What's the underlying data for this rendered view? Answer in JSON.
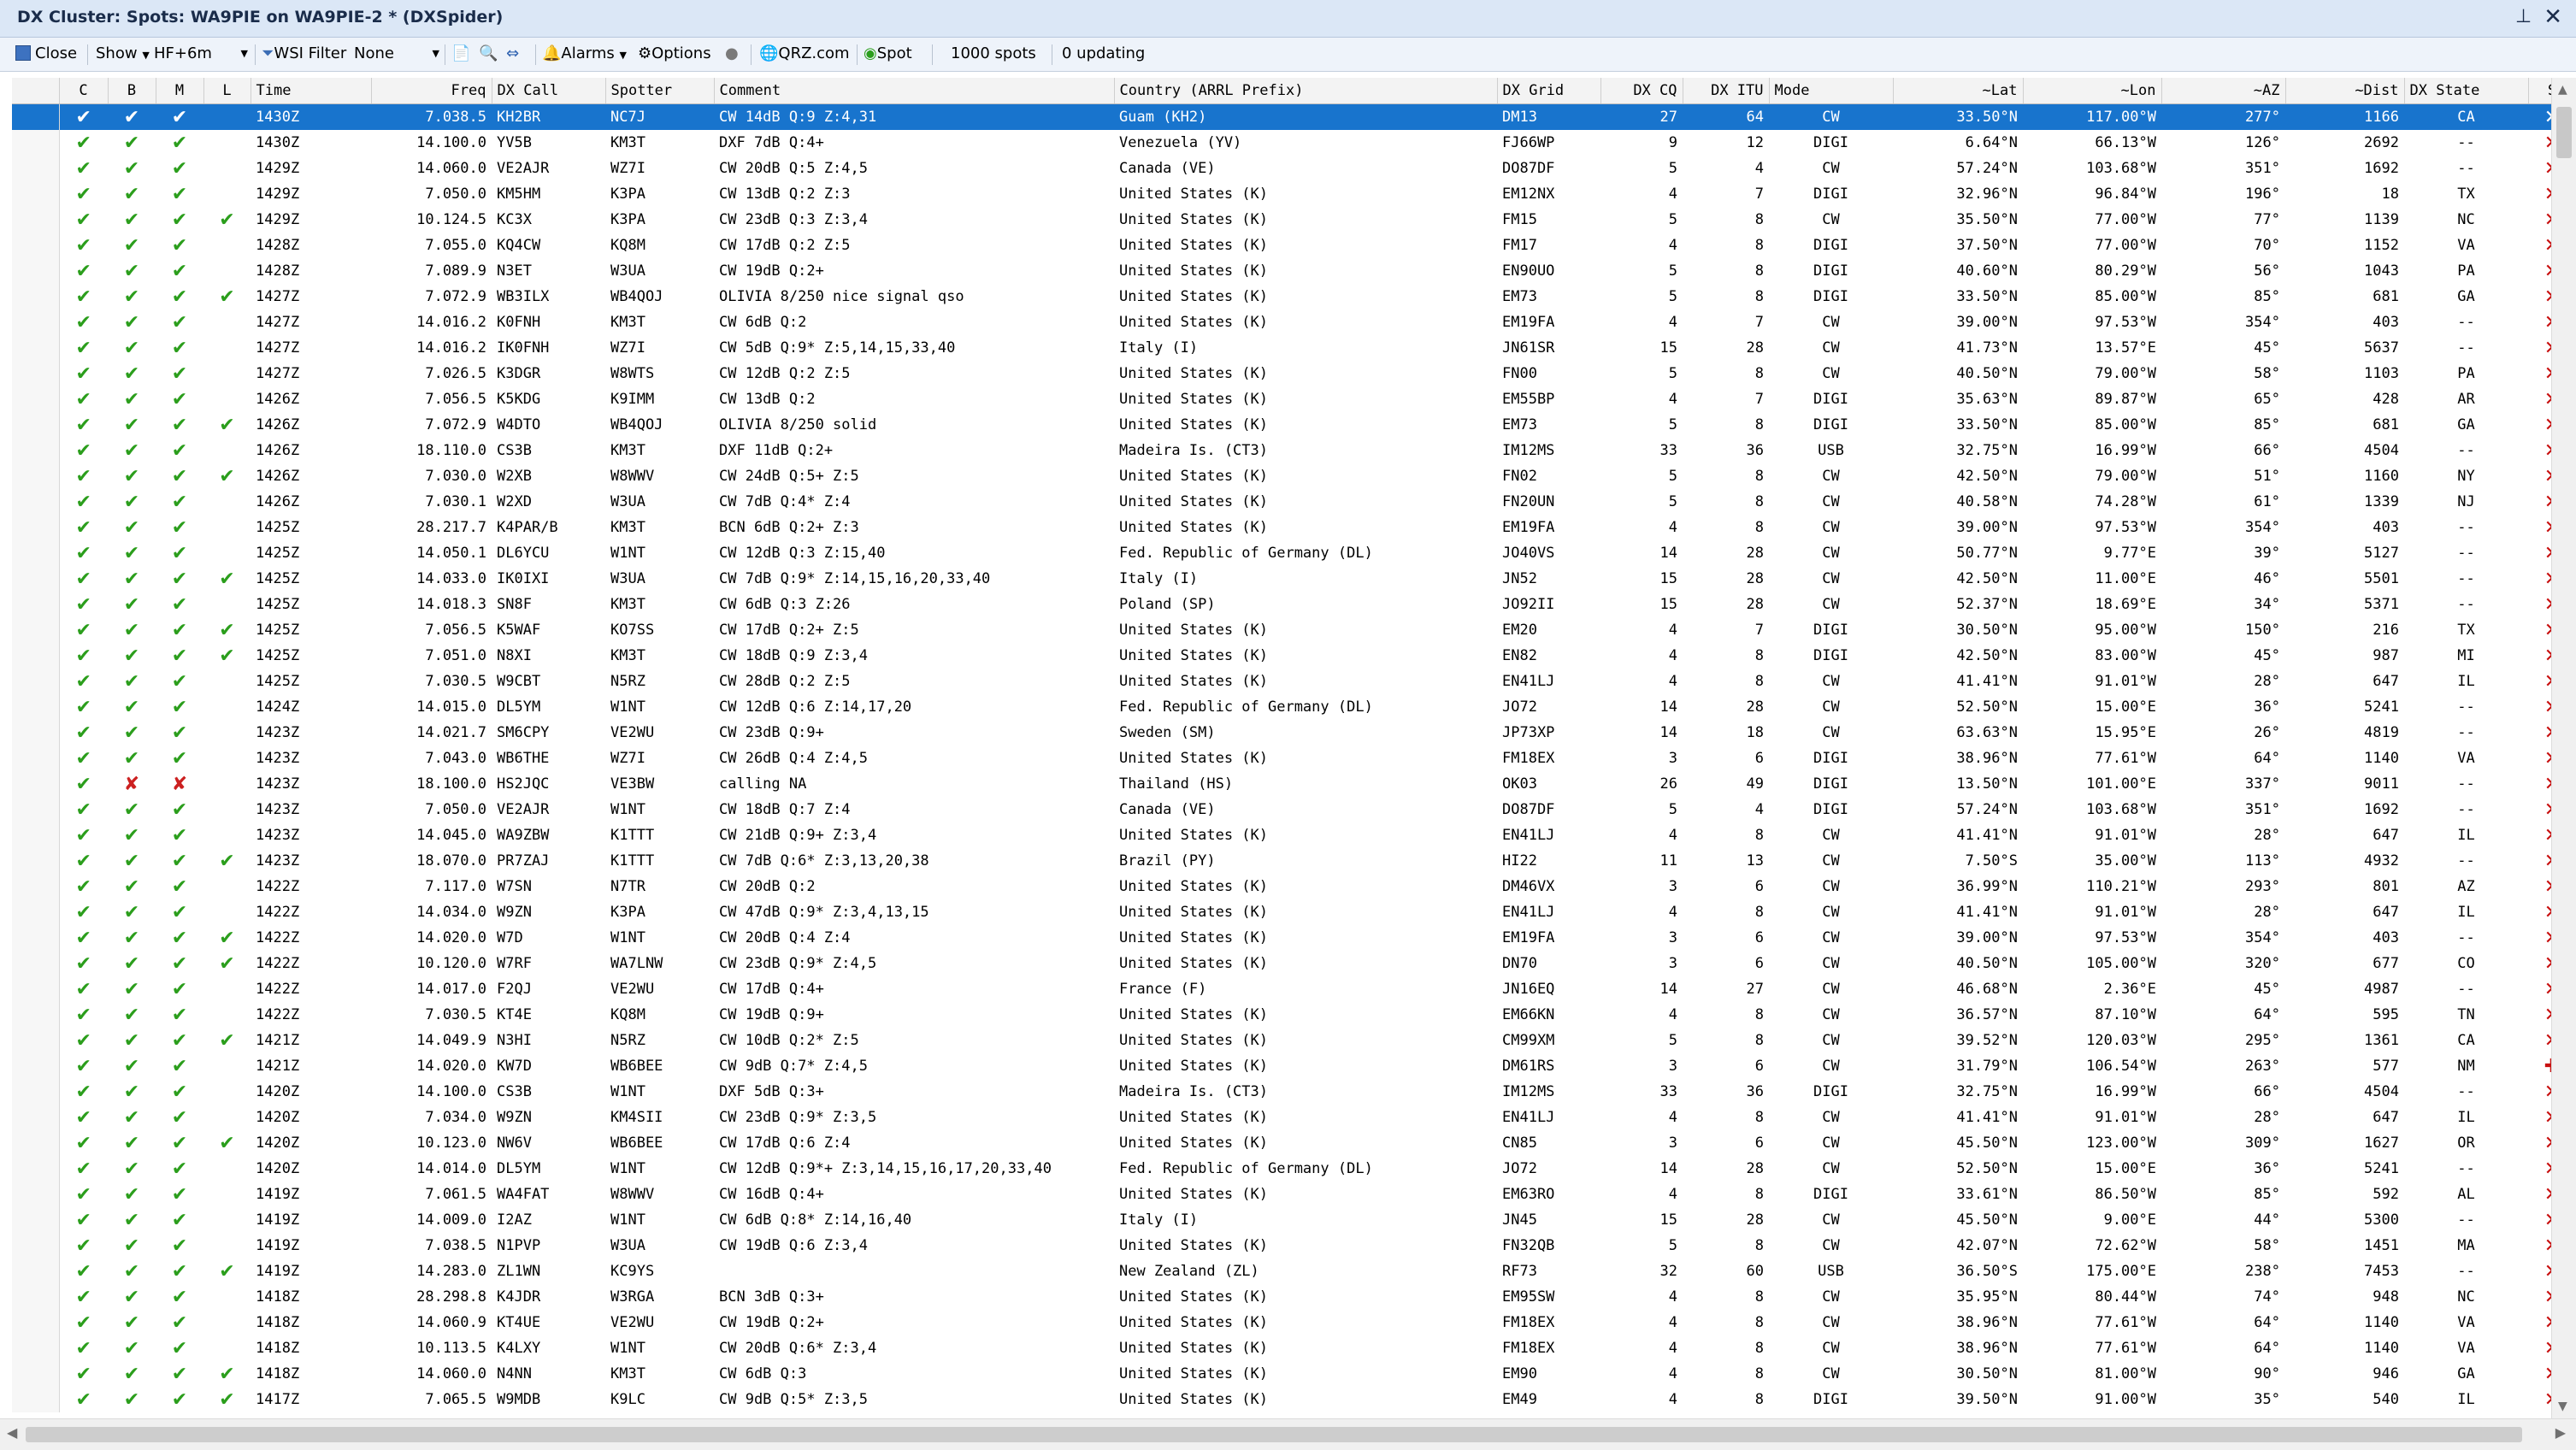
{
  "window": {
    "title": "DX Cluster: Spots: WA9PIE on WA9PIE-2 * (DXSpider)"
  },
  "toolbar": {
    "close_label": "Close",
    "show_label": "Show",
    "band_value": "HF+6m",
    "wsi_filter_label": "WSI Filter",
    "filter_value": "None",
    "alarms_label": "Alarms",
    "options_label": "Options",
    "qrz_label": "QRZ.com",
    "spot_label": "Spot",
    "spots_count": "1000 spots",
    "updating": "0 updating"
  },
  "columns": [
    "C",
    "B",
    "M",
    "L",
    "Time",
    "Freq",
    "DX Call",
    "Spotter",
    "Comment",
    "Country (ARRL Prefix)",
    "DX Grid",
    "DX CQ",
    "DX ITU",
    "Mode",
    "~Lat",
    "~Lon",
    "~AZ",
    "~Dist",
    "DX State",
    "S"
  ],
  "rows": [
    [
      "y",
      "y",
      "y",
      "",
      "1430Z",
      "7.038.5",
      "KH2BR",
      "NC7J",
      "CW  14dB Q:9 Z:4,31",
      "Guam (KH2)",
      "DM13",
      "27",
      "64",
      "CW",
      "33.50°N",
      "117.00°W",
      "277°",
      "1166",
      "CA",
      "x"
    ],
    [
      "y",
      "y",
      "y",
      "",
      "1430Z",
      "14.100.0",
      "YV5B",
      "KM3T",
      "DXF  7dB Q:4+",
      "Venezuela (YV)",
      "FJ66WP",
      "9",
      "12",
      "DIGI",
      "6.64°N",
      "66.13°W",
      "126°",
      "2692",
      "--",
      "x"
    ],
    [
      "y",
      "y",
      "y",
      "",
      "1429Z",
      "14.060.0",
      "VE2AJR",
      "WZ7I",
      "CW  20dB Q:5 Z:4,5",
      "Canada (VE)",
      "DO87DF",
      "5",
      "4",
      "CW",
      "57.24°N",
      "103.68°W",
      "351°",
      "1692",
      "--",
      "x"
    ],
    [
      "y",
      "y",
      "y",
      "",
      "1429Z",
      "7.050.0",
      "KM5HM",
      "K3PA",
      "CW  13dB Q:2 Z:3",
      "United States (K)",
      "EM12NX",
      "4",
      "7",
      "DIGI",
      "32.96°N",
      "96.84°W",
      "196°",
      "18",
      "TX",
      "x"
    ],
    [
      "y",
      "y",
      "y",
      "y",
      "1429Z",
      "10.124.5",
      "KC3X",
      "K3PA",
      "CW  23dB Q:3 Z:3,4",
      "United States (K)",
      "FM15",
      "5",
      "8",
      "CW",
      "35.50°N",
      "77.00°W",
      "77°",
      "1139",
      "NC",
      "x"
    ],
    [
      "y",
      "y",
      "y",
      "",
      "1428Z",
      "7.055.0",
      "KQ4CW",
      "KQ8M",
      "CW  17dB Q:2 Z:5",
      "United States (K)",
      "FM17",
      "4",
      "8",
      "DIGI",
      "37.50°N",
      "77.00°W",
      "70°",
      "1152",
      "VA",
      "x"
    ],
    [
      "y",
      "y",
      "y",
      "",
      "1428Z",
      "7.089.9",
      "N3ET",
      "W3UA",
      "CW  19dB Q:2+",
      "United States (K)",
      "EN90UO",
      "5",
      "8",
      "DIGI",
      "40.60°N",
      "80.29°W",
      "56°",
      "1043",
      "PA",
      "x"
    ],
    [
      "y",
      "y",
      "y",
      "y",
      "1427Z",
      "7.072.9",
      "WB3ILX",
      "WB4QOJ",
      "OLIVIA 8/250 nice signal qso",
      "United States (K)",
      "EM73",
      "5",
      "8",
      "DIGI",
      "33.50°N",
      "85.00°W",
      "85°",
      "681",
      "GA",
      "x"
    ],
    [
      "y",
      "y",
      "y",
      "",
      "1427Z",
      "14.016.2",
      "K0FNH",
      "KM3T",
      "CW   6dB Q:2",
      "United States (K)",
      "EM19FA",
      "4",
      "7",
      "CW",
      "39.00°N",
      "97.53°W",
      "354°",
      "403",
      "--",
      "x"
    ],
    [
      "y",
      "y",
      "y",
      "",
      "1427Z",
      "14.016.2",
      "IK0FNH",
      "WZ7I",
      "CW   5dB Q:9* Z:5,14,15,33,40",
      "Italy (I)",
      "JN61SR",
      "15",
      "28",
      "CW",
      "41.73°N",
      "13.57°E",
      "45°",
      "5637",
      "--",
      "x"
    ],
    [
      "y",
      "y",
      "y",
      "",
      "1427Z",
      "7.026.5",
      "K3DGR",
      "W8WTS",
      "CW  12dB Q:2 Z:5",
      "United States (K)",
      "FN00",
      "5",
      "8",
      "CW",
      "40.50°N",
      "79.00°W",
      "58°",
      "1103",
      "PA",
      "x"
    ],
    [
      "y",
      "y",
      "y",
      "",
      "1426Z",
      "7.056.5",
      "K5KDG",
      "K9IMM",
      "CW  13dB Q:2",
      "United States (K)",
      "EM55BP",
      "4",
      "7",
      "DIGI",
      "35.63°N",
      "89.87°W",
      "65°",
      "428",
      "AR",
      "x"
    ],
    [
      "y",
      "y",
      "y",
      "y",
      "1426Z",
      "7.072.9",
      "W4DTO",
      "WB4QOJ",
      "OLIVIA 8/250 solid",
      "United States (K)",
      "EM73",
      "5",
      "8",
      "DIGI",
      "33.50°N",
      "85.00°W",
      "85°",
      "681",
      "GA",
      "x"
    ],
    [
      "y",
      "y",
      "y",
      "",
      "1426Z",
      "18.110.0",
      "CS3B",
      "KM3T",
      "DXF 11dB Q:2+",
      "Madeira Is. (CT3)",
      "IM12MS",
      "33",
      "36",
      "USB",
      "32.75°N",
      "16.99°W",
      "66°",
      "4504",
      "--",
      "x"
    ],
    [
      "y",
      "y",
      "y",
      "y",
      "1426Z",
      "7.030.0",
      "W2XB",
      "W8WWV",
      "CW  24dB Q:5+ Z:5",
      "United States (K)",
      "FN02",
      "5",
      "8",
      "CW",
      "42.50°N",
      "79.00°W",
      "51°",
      "1160",
      "NY",
      "x"
    ],
    [
      "y",
      "y",
      "y",
      "",
      "1426Z",
      "7.030.1",
      "W2XD",
      "W3UA",
      "CW   7dB Q:4* Z:4",
      "United States (K)",
      "FN20UN",
      "5",
      "8",
      "CW",
      "40.58°N",
      "74.28°W",
      "61°",
      "1339",
      "NJ",
      "x"
    ],
    [
      "y",
      "y",
      "y",
      "",
      "1425Z",
      "28.217.7",
      "K4PAR/B",
      "KM3T",
      "BCN  6dB Q:2+ Z:3",
      "United States (K)",
      "EM19FA",
      "4",
      "8",
      "CW",
      "39.00°N",
      "97.53°W",
      "354°",
      "403",
      "--",
      "x"
    ],
    [
      "y",
      "y",
      "y",
      "",
      "1425Z",
      "14.050.1",
      "DL6YCU",
      "W1NT",
      "CW  12dB Q:3 Z:15,40",
      "Fed. Republic of Germany (DL)",
      "JO40VS",
      "14",
      "28",
      "CW",
      "50.77°N",
      "9.77°E",
      "39°",
      "5127",
      "--",
      "x"
    ],
    [
      "y",
      "y",
      "y",
      "y",
      "1425Z",
      "14.033.0",
      "IK0IXI",
      "W3UA",
      "CW   7dB Q:9* Z:14,15,16,20,33,40",
      "Italy (I)",
      "JN52",
      "15",
      "28",
      "CW",
      "42.50°N",
      "11.00°E",
      "46°",
      "5501",
      "--",
      "x"
    ],
    [
      "y",
      "y",
      "y",
      "",
      "1425Z",
      "14.018.3",
      "SN8F",
      "KM3T",
      "CW   6dB Q:3 Z:26",
      "Poland (SP)",
      "JO92II",
      "15",
      "28",
      "CW",
      "52.37°N",
      "18.69°E",
      "34°",
      "5371",
      "--",
      "x"
    ],
    [
      "y",
      "y",
      "y",
      "y",
      "1425Z",
      "7.056.5",
      "K5WAF",
      "KO7SS",
      "CW  17dB Q:2+ Z:5",
      "United States (K)",
      "EM20",
      "4",
      "7",
      "DIGI",
      "30.50°N",
      "95.00°W",
      "150°",
      "216",
      "TX",
      "x"
    ],
    [
      "y",
      "y",
      "y",
      "y",
      "1425Z",
      "7.051.0",
      "N8XI",
      "KM3T",
      "CW  18dB Q:9 Z:3,4",
      "United States (K)",
      "EN82",
      "4",
      "8",
      "DIGI",
      "42.50°N",
      "83.00°W",
      "45°",
      "987",
      "MI",
      "x"
    ],
    [
      "y",
      "y",
      "y",
      "",
      "1425Z",
      "7.030.5",
      "W9CBT",
      "N5RZ",
      "CW  28dB Q:2 Z:5",
      "United States (K)",
      "EN41LJ",
      "4",
      "8",
      "CW",
      "41.41°N",
      "91.01°W",
      "28°",
      "647",
      "IL",
      "x"
    ],
    [
      "y",
      "y",
      "y",
      "",
      "1424Z",
      "14.015.0",
      "DL5YM",
      "W1NT",
      "CW  12dB Q:6 Z:14,17,20",
      "Fed. Republic of Germany (DL)",
      "JO72",
      "14",
      "28",
      "CW",
      "52.50°N",
      "15.00°E",
      "36°",
      "5241",
      "--",
      "x"
    ],
    [
      "y",
      "y",
      "y",
      "",
      "1423Z",
      "14.021.7",
      "SM6CPY",
      "VE2WU",
      "CW  23dB Q:9+",
      "Sweden (SM)",
      "JP73XP",
      "14",
      "18",
      "CW",
      "63.63°N",
      "15.95°E",
      "26°",
      "4819",
      "--",
      "x"
    ],
    [
      "y",
      "y",
      "y",
      "",
      "1423Z",
      "7.043.0",
      "WB6THE",
      "WZ7I",
      "CW  26dB Q:4 Z:4,5",
      "United States (K)",
      "FM18EX",
      "3",
      "6",
      "DIGI",
      "38.96°N",
      "77.61°W",
      "64°",
      "1140",
      "VA",
      "x"
    ],
    [
      "y",
      "n",
      "n",
      "",
      "1423Z",
      "18.100.0",
      "HS2JQC",
      "VE3BW",
      "calling NA",
      "Thailand (HS)",
      "OK03",
      "26",
      "49",
      "DIGI",
      "13.50°N",
      "101.00°E",
      "337°",
      "9011",
      "--",
      "x"
    ],
    [
      "y",
      "y",
      "y",
      "",
      "1423Z",
      "7.050.0",
      "VE2AJR",
      "W1NT",
      "CW  18dB Q:7 Z:4",
      "Canada (VE)",
      "DO87DF",
      "5",
      "4",
      "DIGI",
      "57.24°N",
      "103.68°W",
      "351°",
      "1692",
      "--",
      "x"
    ],
    [
      "y",
      "y",
      "y",
      "",
      "1423Z",
      "14.045.0",
      "WA9ZBW",
      "K1TTT",
      "CW  21dB Q:9+ Z:3,4",
      "United States (K)",
      "EN41LJ",
      "4",
      "8",
      "CW",
      "41.41°N",
      "91.01°W",
      "28°",
      "647",
      "IL",
      "x"
    ],
    [
      "y",
      "y",
      "y",
      "y",
      "1423Z",
      "18.070.0",
      "PR7ZAJ",
      "K1TTT",
      "CW   7dB Q:6* Z:3,13,20,38",
      "Brazil (PY)",
      "HI22",
      "11",
      "13",
      "CW",
      "7.50°S",
      "35.00°W",
      "113°",
      "4932",
      "--",
      "x"
    ],
    [
      "y",
      "y",
      "y",
      "",
      "1422Z",
      "7.117.0",
      "W7SN",
      "N7TR",
      "CW  20dB Q:2",
      "United States (K)",
      "DM46VX",
      "3",
      "6",
      "CW",
      "36.99°N",
      "110.21°W",
      "293°",
      "801",
      "AZ",
      "x"
    ],
    [
      "y",
      "y",
      "y",
      "",
      "1422Z",
      "14.034.0",
      "W9ZN",
      "K3PA",
      "CW  47dB Q:9* Z:3,4,13,15",
      "United States (K)",
      "EN41LJ",
      "4",
      "8",
      "CW",
      "41.41°N",
      "91.01°W",
      "28°",
      "647",
      "IL",
      "x"
    ],
    [
      "y",
      "y",
      "y",
      "y",
      "1422Z",
      "14.020.0",
      "W7D",
      "W1NT",
      "CW  20dB Q:4 Z:4",
      "United States (K)",
      "EM19FA",
      "3",
      "6",
      "CW",
      "39.00°N",
      "97.53°W",
      "354°",
      "403",
      "--",
      "x"
    ],
    [
      "y",
      "y",
      "y",
      "y",
      "1422Z",
      "10.120.0",
      "W7RF",
      "WA7LNW",
      "CW  23dB Q:9* Z:4,5",
      "United States (K)",
      "DN70",
      "3",
      "6",
      "CW",
      "40.50°N",
      "105.00°W",
      "320°",
      "677",
      "CO",
      "x"
    ],
    [
      "y",
      "y",
      "y",
      "",
      "1422Z",
      "14.017.0",
      "F2QJ",
      "VE2WU",
      "CW  17dB Q:4+",
      "France (F)",
      "JN16EQ",
      "14",
      "27",
      "CW",
      "46.68°N",
      "2.36°E",
      "45°",
      "4987",
      "--",
      "x"
    ],
    [
      "y",
      "y",
      "y",
      "",
      "1422Z",
      "7.030.5",
      "KT4E",
      "KQ8M",
      "CW  19dB Q:9+",
      "United States (K)",
      "EM66KN",
      "4",
      "8",
      "CW",
      "36.57°N",
      "87.10°W",
      "64°",
      "595",
      "TN",
      "x"
    ],
    [
      "y",
      "y",
      "y",
      "y",
      "1421Z",
      "14.049.9",
      "N3HI",
      "N5RZ",
      "CW  10dB Q:2* Z:5",
      "United States (K)",
      "CM99XM",
      "5",
      "8",
      "CW",
      "39.52°N",
      "120.03°W",
      "295°",
      "1361",
      "CA",
      "x"
    ],
    [
      "y",
      "y",
      "y",
      "",
      "1421Z",
      "14.020.0",
      "KW7D",
      "WB6BEE",
      "CW   9dB Q:7* Z:4,5",
      "United States (K)",
      "DM61RS",
      "3",
      "6",
      "CW",
      "31.79°N",
      "106.54°W",
      "263°",
      "577",
      "NM",
      "+"
    ],
    [
      "y",
      "y",
      "y",
      "",
      "1420Z",
      "14.100.0",
      "CS3B",
      "W1NT",
      "DXF  5dB Q:3+",
      "Madeira Is. (CT3)",
      "IM12MS",
      "33",
      "36",
      "DIGI",
      "32.75°N",
      "16.99°W",
      "66°",
      "4504",
      "--",
      "x"
    ],
    [
      "y",
      "y",
      "y",
      "",
      "1420Z",
      "7.034.0",
      "W9ZN",
      "KM4SII",
      "CW  23dB Q:9* Z:3,5",
      "United States (K)",
      "EN41LJ",
      "4",
      "8",
      "CW",
      "41.41°N",
      "91.01°W",
      "28°",
      "647",
      "IL",
      "x"
    ],
    [
      "y",
      "y",
      "y",
      "y",
      "1420Z",
      "10.123.0",
      "NW6V",
      "WB6BEE",
      "CW  17dB Q:6 Z:4",
      "United States (K)",
      "CN85",
      "3",
      "6",
      "CW",
      "45.50°N",
      "123.00°W",
      "309°",
      "1627",
      "OR",
      "x"
    ],
    [
      "y",
      "y",
      "y",
      "",
      "1420Z",
      "14.014.0",
      "DL5YM",
      "W1NT",
      "CW  12dB Q:9*+ Z:3,14,15,16,17,20,33,40",
      "Fed. Republic of Germany (DL)",
      "JO72",
      "14",
      "28",
      "CW",
      "52.50°N",
      "15.00°E",
      "36°",
      "5241",
      "--",
      "x"
    ],
    [
      "y",
      "y",
      "y",
      "",
      "1419Z",
      "7.061.5",
      "WA4FAT",
      "W8WWV",
      "CW  16dB Q:4+",
      "United States (K)",
      "EM63RO",
      "4",
      "8",
      "DIGI",
      "33.61°N",
      "86.50°W",
      "85°",
      "592",
      "AL",
      "x"
    ],
    [
      "y",
      "y",
      "y",
      "",
      "1419Z",
      "14.009.0",
      "I2AZ",
      "W1NT",
      "CW   6dB Q:8* Z:14,16,40",
      "Italy (I)",
      "JN45",
      "15",
      "28",
      "CW",
      "45.50°N",
      "9.00°E",
      "44°",
      "5300",
      "--",
      "x"
    ],
    [
      "y",
      "y",
      "y",
      "",
      "1419Z",
      "7.038.5",
      "N1PVP",
      "W3UA",
      "CW  19dB Q:6 Z:3,4",
      "United States (K)",
      "FN32QB",
      "5",
      "8",
      "CW",
      "42.07°N",
      "72.62°W",
      "58°",
      "1451",
      "MA",
      "x"
    ],
    [
      "y",
      "y",
      "y",
      "y",
      "1419Z",
      "14.283.0",
      "ZL1WN",
      "KC9YS",
      "",
      "New Zealand (ZL)",
      "RF73",
      "32",
      "60",
      "USB",
      "36.50°S",
      "175.00°E",
      "238°",
      "7453",
      "--",
      "x"
    ],
    [
      "y",
      "y",
      "y",
      "",
      "1418Z",
      "28.298.8",
      "K4JDR",
      "W3RGA",
      "BCN  3dB Q:3+",
      "United States (K)",
      "EM95SW",
      "4",
      "8",
      "CW",
      "35.95°N",
      "80.44°W",
      "74°",
      "948",
      "NC",
      "x"
    ],
    [
      "y",
      "y",
      "y",
      "",
      "1418Z",
      "14.060.9",
      "KT4UE",
      "VE2WU",
      "CW  19dB Q:2+",
      "United States (K)",
      "FM18EX",
      "4",
      "8",
      "CW",
      "38.96°N",
      "77.61°W",
      "64°",
      "1140",
      "VA",
      "x"
    ],
    [
      "y",
      "y",
      "y",
      "",
      "1418Z",
      "10.113.5",
      "K4LXY",
      "W1NT",
      "CW  20dB Q:6* Z:3,4",
      "United States (K)",
      "FM18EX",
      "4",
      "8",
      "CW",
      "38.96°N",
      "77.61°W",
      "64°",
      "1140",
      "VA",
      "x"
    ],
    [
      "y",
      "y",
      "y",
      "y",
      "1418Z",
      "14.060.0",
      "N4NN",
      "KM3T",
      "CW   6dB Q:3",
      "United States (K)",
      "EM90",
      "4",
      "8",
      "CW",
      "30.50°N",
      "81.00°W",
      "90°",
      "946",
      "GA",
      "x"
    ],
    [
      "y",
      "y",
      "y",
      "y",
      "1417Z",
      "7.065.5",
      "W9MDB",
      "K9LC",
      "CW   9dB Q:5* Z:3,5",
      "United States (K)",
      "EM49",
      "4",
      "8",
      "DIGI",
      "39.50°N",
      "91.00°W",
      "35°",
      "540",
      "IL",
      "x"
    ]
  ],
  "colors": {
    "selected_row": "#1874cd",
    "check": "#2b9e1c",
    "cross": "#cc2020",
    "title_bar": "#dbe7f6"
  },
  "icons": {
    "check": "check-icon",
    "cross": "cross-icon",
    "delete": "delete-icon",
    "plus": "plus-icon"
  }
}
